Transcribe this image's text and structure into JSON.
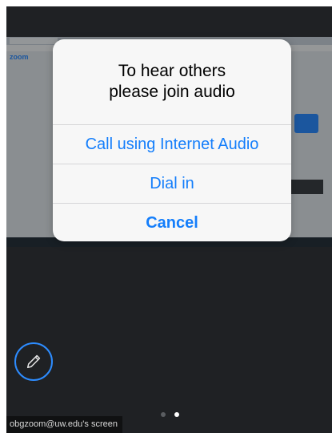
{
  "dialog": {
    "title_line1": "To hear others",
    "title_line2": "please join audio",
    "buttons": {
      "internet_audio": "Call using Internet Audio",
      "dial_in": "Dial in",
      "cancel": "Cancel"
    }
  },
  "shared_screen": {
    "brand": "zoom"
  },
  "annotate_button": {
    "icon": "pencil-icon"
  },
  "pagination": {
    "total": 2,
    "active": 2
  },
  "screen_label": "obgzoom@uw.edu's screen",
  "colors": {
    "accent": "#147efb",
    "zoom_blue": "#2d8cff",
    "background": "#1f2124"
  }
}
